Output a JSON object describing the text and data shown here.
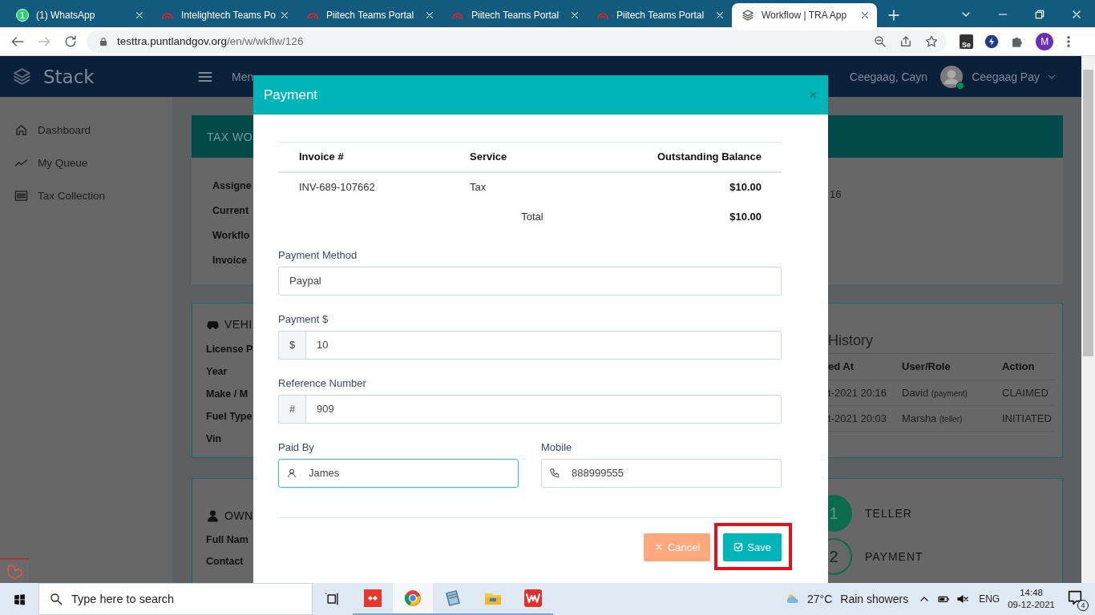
{
  "browser": {
    "tabs": [
      {
        "title": "(1) WhatsApp",
        "kind": "chat",
        "badge": "1",
        "selected": false
      },
      {
        "title": "Intelightech Teams Po",
        "kind": "arc",
        "selected": false
      },
      {
        "title": "Piitech Teams Portal",
        "kind": "arc",
        "selected": false
      },
      {
        "title": "Piitech Teams Portal",
        "kind": "arc",
        "selected": false
      },
      {
        "title": "Piitech Teams Portal",
        "kind": "arc",
        "selected": false
      },
      {
        "title": "Workflow | TRA App",
        "kind": "layers",
        "selected": true
      }
    ],
    "address": {
      "host": "testtra.puntlandgov.org",
      "path": "/en/w/wkflw/126"
    },
    "extension_label": "Se",
    "profile_initial": "M"
  },
  "app": {
    "brand": "Stack",
    "menu_label": "Men",
    "user_name": "Ceegaag, Cayn",
    "account": "Ceegaag Pay",
    "online": true
  },
  "sidebar": {
    "items": [
      {
        "label": "Dashboard",
        "kind": "home"
      },
      {
        "label": "My Queue",
        "kind": "trend"
      },
      {
        "label": "Tax Collection",
        "kind": "list"
      }
    ]
  },
  "workflow_card": {
    "title": "TAX WO",
    "fields": [
      "Assigne",
      "Current",
      "Workflo",
      "Invoice"
    ],
    "side_text": "16"
  },
  "vehicle_card": {
    "title": "VEHI",
    "fields": [
      "License P",
      "Year",
      "Make / M",
      "Fuel Type",
      "Vin"
    ],
    "history": {
      "title": "History",
      "columns": [
        "ed At",
        "User/Role",
        "Action"
      ],
      "rows": [
        {
          "time": "t-2021 20:16",
          "user": "David",
          "role": "(payment)",
          "action": "CLAIMED"
        },
        {
          "time": "t-2021 20:03",
          "user": "Marsha",
          "role": "(teller)",
          "action": "INITIATED"
        }
      ]
    }
  },
  "owner_card": {
    "title": "OWN",
    "fields": [
      "Full Nam",
      "Contact"
    ],
    "steps": [
      {
        "number": "1",
        "label": "TELLER",
        "done": true
      },
      {
        "number": "2",
        "label": "PAYMENT",
        "done": false
      }
    ]
  },
  "modal": {
    "title": "Payment",
    "close": "×",
    "table": {
      "columns": [
        "Invoice #",
        "Service",
        "Outstanding Balance"
      ],
      "rows": [
        [
          "INV-689-107662",
          "Tax",
          "$10.00"
        ]
      ],
      "total_label": "Total",
      "total": "$10.00"
    },
    "field_rows": [
      [
        {
          "label": "Payment Method",
          "value": "Paypal",
          "kind": "plain",
          "focused": false
        }
      ],
      [
        {
          "label": "Payment $",
          "value": "10",
          "kind": "addon",
          "addon": "$",
          "focused": false
        }
      ],
      [
        {
          "label": "Reference Number",
          "value": "909",
          "kind": "addon",
          "addon": "#",
          "focused": false
        }
      ],
      [
        {
          "label": "Paid By",
          "value": "James",
          "kind": "person",
          "focused": true
        },
        {
          "label": "Mobile",
          "value": "888999555",
          "kind": "phone",
          "focused": false
        }
      ]
    ],
    "buttons": [
      {
        "label": "Cancel",
        "kind": "cancel",
        "highlighted": false
      },
      {
        "label": "Save",
        "kind": "save",
        "highlighted": true
      }
    ]
  },
  "taskbar": {
    "search_placeholder": "Type here to search",
    "apps": [
      {
        "kind": "diamonds",
        "selected": false
      },
      {
        "kind": "rings",
        "selected": true
      },
      {
        "kind": "notepad",
        "selected": false
      },
      {
        "kind": "folder",
        "selected": false
      },
      {
        "kind": "zigzag",
        "selected": false
      }
    ],
    "weather": {
      "temp": "27°C",
      "text": "Rain showers"
    },
    "language": "ENG",
    "time": "14:48",
    "date": "09-12-2021",
    "notifications": "4"
  }
}
